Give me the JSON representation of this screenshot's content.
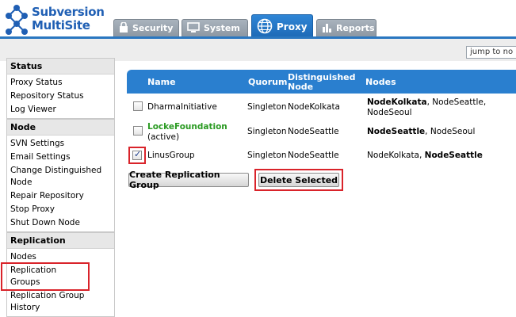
{
  "brand": {
    "line1": "Subversion",
    "line2": "MultiSite"
  },
  "tabs": [
    {
      "label": "Security",
      "icon": "lock-icon"
    },
    {
      "label": "System",
      "icon": "monitor-icon"
    },
    {
      "label": "Proxy",
      "icon": "globe-icon",
      "active": true
    },
    {
      "label": "Reports",
      "icon": "bar-chart-icon"
    }
  ],
  "jump": {
    "placeholder": "jump to no"
  },
  "sidebar": {
    "status": {
      "title": "Status",
      "items": [
        "Proxy Status",
        "Repository Status",
        "Log Viewer"
      ]
    },
    "node": {
      "title": "Node",
      "items": [
        "SVN Settings",
        "Email Settings",
        "Change Distinguished Node",
        "Repair Repository",
        "Stop Proxy",
        "Shut Down Node"
      ]
    },
    "replication": {
      "title": "Replication",
      "items": [
        "Nodes",
        "Replication Groups",
        "Replication Group History"
      ]
    }
  },
  "table": {
    "headers": {
      "name": "Name",
      "quorum": "Quorum",
      "dnode": "Distinguished Node",
      "nodes": "Nodes"
    },
    "rows": [
      {
        "name": "DharmaInitiative",
        "sub": "",
        "quorum": "Singleton",
        "dnode": "NodeKolkata",
        "nodes_bold": "NodeKolkata",
        "nodes_rest": ", NodeSeattle, NodeSeoul",
        "checked": false
      },
      {
        "name": "LockeFoundation",
        "sub": "(active)",
        "quorum": "Singleton",
        "dnode": "NodeSeattle",
        "nodes_bold": "NodeSeattle",
        "nodes_rest": ", NodeSeoul",
        "checked": false
      },
      {
        "name": "LinusGroup",
        "sub": "",
        "quorum": "Singleton",
        "dnode": "NodeSeattle",
        "nodes_pre": "NodeKolkata, ",
        "nodes_bold": "NodeSeattle",
        "checked": true
      }
    ]
  },
  "buttons": {
    "create": "Create Replication Group",
    "delete": "Delete Selected"
  },
  "colors": {
    "accent": "#2a7fcf",
    "highlight": "#d9232a",
    "active_name": "#2a9a22"
  }
}
